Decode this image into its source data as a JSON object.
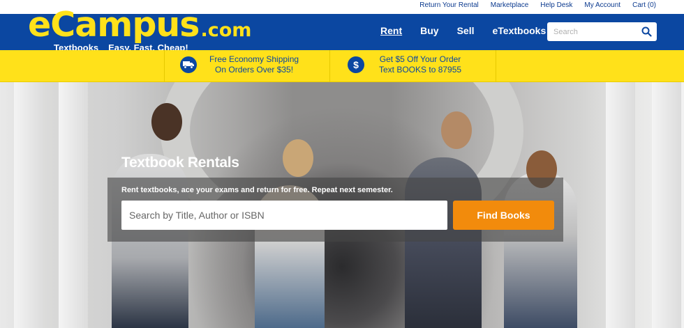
{
  "utility_nav": {
    "items": [
      "Return Your Rental",
      "Marketplace",
      "Help Desk",
      "My Account",
      "Cart (0)"
    ]
  },
  "logo": {
    "main": "eCampus",
    "suffix": ".com",
    "tagline_left": "Textbooks",
    "tagline_right": "Easy. Fast. Cheap!"
  },
  "main_nav": {
    "items": [
      "Rent",
      "Buy",
      "Sell",
      "eTextbooks"
    ],
    "active": "Rent"
  },
  "header_search": {
    "placeholder": "Search"
  },
  "promos": [
    {
      "icon": "truck-icon",
      "line1": "Free Economy Shipping",
      "line2": "On Orders Over $35!"
    },
    {
      "icon": "dollar-icon",
      "line1": "Get $5 Off Your Order",
      "line2": "Text BOOKS to 87955"
    }
  ],
  "hero": {
    "title": "Textbook Rentals",
    "subtitle": "Rent textbooks, ace your exams and return for free. Repeat next semester.",
    "search_placeholder": "Search by Title, Author or ISBN",
    "button_label": "Find Books"
  },
  "colors": {
    "brand_blue": "#0b47a1",
    "brand_yellow": "#ffe11a",
    "cta_orange": "#f28b0c",
    "link_blue": "#0b3a8f"
  }
}
